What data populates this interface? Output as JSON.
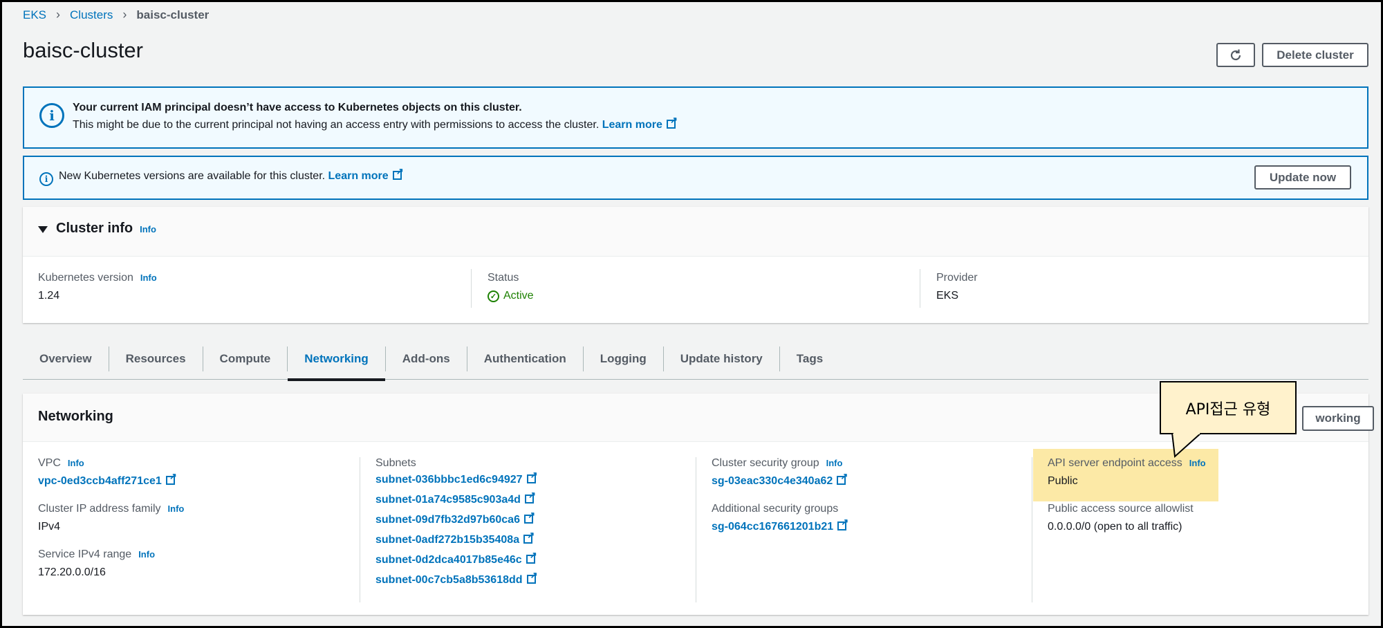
{
  "breadcrumb": {
    "items": [
      "EKS",
      "Clusters"
    ],
    "current": "baisc-cluster",
    "separator": ">"
  },
  "page": {
    "title": "baisc-cluster"
  },
  "header_buttons": {
    "refresh_icon": "refresh-icon",
    "delete": "Delete cluster"
  },
  "alerts": {
    "iam": {
      "icon": "info-icon",
      "title": "Your current IAM principal doesn’t have access to Kubernetes objects on this cluster.",
      "body": "This might be due to the current principal not having an access entry with permissions to access the cluster.",
      "link": "Learn more"
    },
    "version": {
      "icon": "info-icon",
      "body": "New Kubernetes versions are available for this cluster.",
      "link": "Learn more",
      "button": "Update now"
    }
  },
  "cluster_info": {
    "title": "Cluster info",
    "info": "Info",
    "k8s_version_label": "Kubernetes version",
    "k8s_version": "1.24",
    "status_label": "Status",
    "status": "Active",
    "provider_label": "Provider",
    "provider": "EKS"
  },
  "tabs": [
    "Overview",
    "Resources",
    "Compute",
    "Networking",
    "Add-ons",
    "Authentication",
    "Logging",
    "Update history",
    "Tags"
  ],
  "active_tab": "Networking",
  "networking": {
    "title": "Networking",
    "manage_button": "working",
    "info": "Info",
    "vpc_label": "VPC",
    "vpc": "vpc-0ed3ccb4aff271ce1",
    "ip_family_label": "Cluster IP address family",
    "ip_family": "IPv4",
    "service_range_label": "Service IPv4 range",
    "service_range": "172.20.0.0/16",
    "subnets_label": "Subnets",
    "subnets": [
      "subnet-036bbbc1ed6c94927",
      "subnet-01a74c9585c903a4d",
      "subnet-09d7fb32d97b60ca6",
      "subnet-0adf272b15b35408a",
      "subnet-0d2dca4017b85e46c",
      "subnet-00c7cb5a8b53618dd"
    ],
    "cluster_sg_label": "Cluster security group",
    "cluster_sg": "sg-03eac330c4e340a62",
    "additional_sg_label": "Additional security groups",
    "additional_sg": "sg-064cc167661201b21",
    "api_access_label": "API server endpoint access",
    "api_access": "Public",
    "allowlist_label": "Public access source allowlist",
    "allowlist": "0.0.0.0/0 (open to all traffic)"
  },
  "callout": {
    "text": "API접근 유형"
  },
  "colors": {
    "link": "#0073bb",
    "active_status": "#1d8102",
    "highlight": "#fce9a6",
    "callout_bg": "#fff2cc"
  }
}
